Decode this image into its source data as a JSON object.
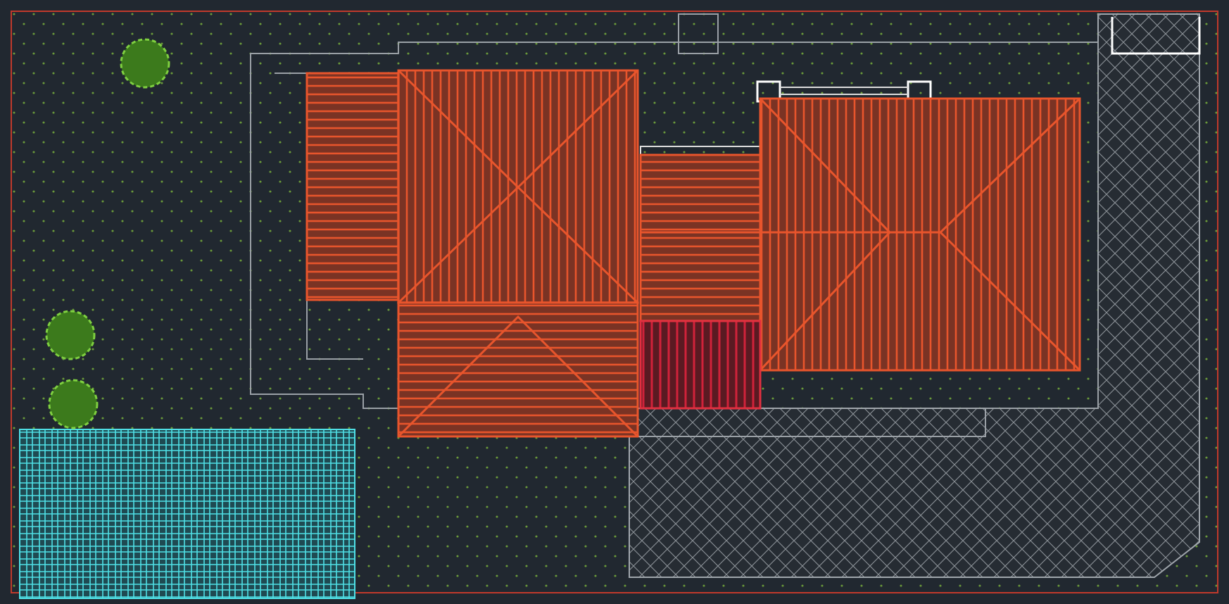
{
  "drawing": {
    "kind": "roof-plan"
  }
}
